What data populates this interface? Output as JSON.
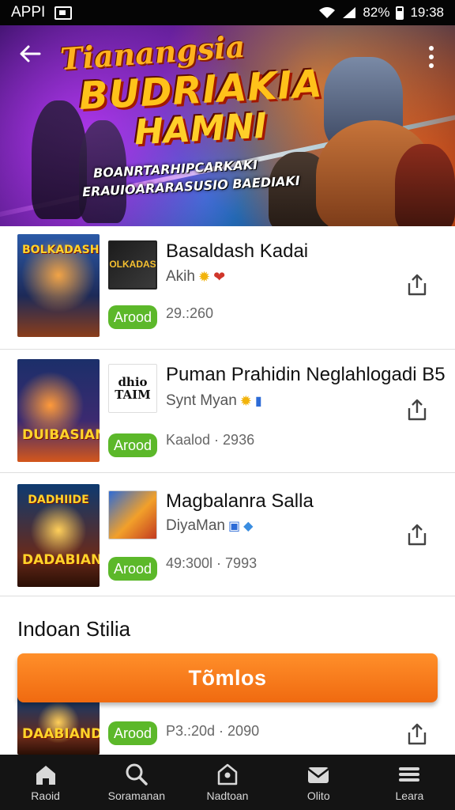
{
  "status_bar": {
    "left_label": "APPI",
    "battery_text": "82%",
    "time": "19:38"
  },
  "hero": {
    "title_line1": "Tianangsia",
    "title_line2": "BUDRIAKIA",
    "title_line3": "HAMNI",
    "subtitle_line1": "BOANRTARHIPCARKAKI",
    "subtitle_line2": "ERAUIOARARASUSIO BAEDIAKI"
  },
  "games": [
    {
      "title": "Basaldash Kadai",
      "developer": "Akih",
      "badge": "Arood",
      "meta": "29.:260",
      "thumb_text": "BOLKADASH",
      "logo_text": "BOLKADASH"
    },
    {
      "title": "Puman Prahidin Neglahlogadi B5",
      "developer": "Synt Myan",
      "badge": "Arood",
      "meta": "Kaalod · 2936",
      "thumb_text": "DUIBASIAN",
      "logo_text": "dhio TAIM"
    },
    {
      "title": "Magbalanra Salla",
      "developer": "DiyaMan",
      "badge": "Arood",
      "meta": "49:300l · 7993",
      "thumb_text": "DADABIAND",
      "thumb_text_top": "DADHIIDE",
      "logo_text": ""
    },
    {
      "title": "",
      "developer": "",
      "badge": "Arood",
      "meta": "P3.:20d · 2090",
      "thumb_text": "DAABIAND"
    }
  ],
  "section": {
    "title": "Indoan Stilia"
  },
  "primary_button": {
    "label": "Tõmlos"
  },
  "bottom_nav": {
    "items": [
      {
        "label": "Raoid",
        "icon": "home-icon"
      },
      {
        "label": "Soramanan",
        "icon": "search-icon"
      },
      {
        "label": "Nadtoan",
        "icon": "shield-home-icon"
      },
      {
        "label": "Olito",
        "icon": "inbox-icon"
      },
      {
        "label": "Leara",
        "icon": "menu-icon"
      }
    ]
  }
}
